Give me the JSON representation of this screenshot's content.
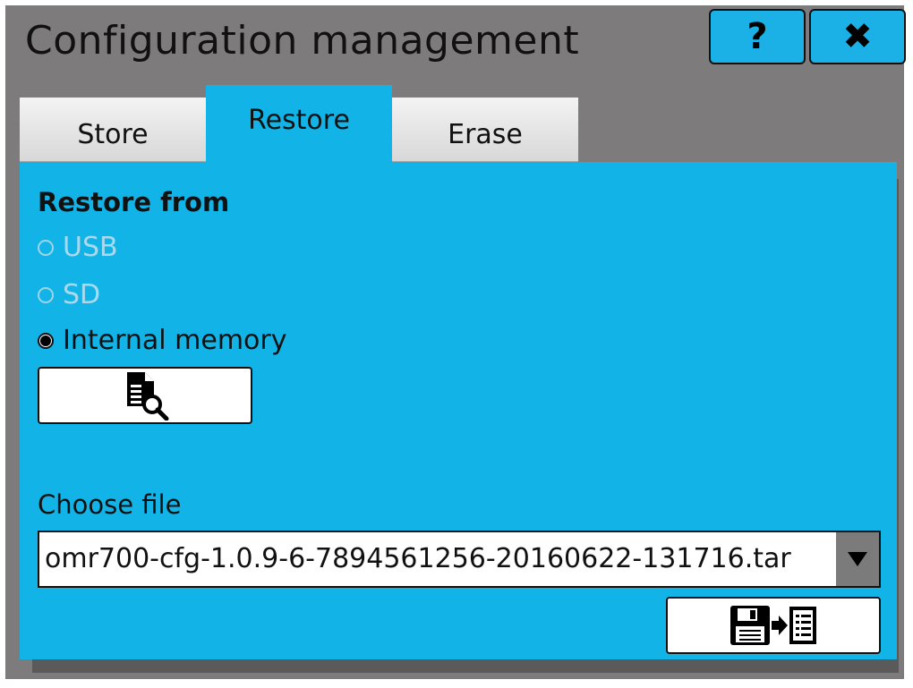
{
  "window": {
    "title": "Configuration management",
    "help_label": "?",
    "close_label": "✖"
  },
  "tabs": [
    {
      "label": "Store",
      "active": false
    },
    {
      "label": "Restore",
      "active": true
    },
    {
      "label": "Erase",
      "active": false
    }
  ],
  "restore": {
    "section_title": "Restore from",
    "options": [
      {
        "label": "USB",
        "selected": false,
        "enabled": false
      },
      {
        "label": "SD",
        "selected": false,
        "enabled": false
      },
      {
        "label": "Internal memory",
        "selected": true,
        "enabled": true
      }
    ],
    "browse_icon": "document-search-icon",
    "choose_file_label": "Choose file",
    "file_value": "omr700-cfg-1.0.9-6-7894561256-20160622-131716.tar",
    "apply_icon": "floppy-to-list-icon"
  }
}
